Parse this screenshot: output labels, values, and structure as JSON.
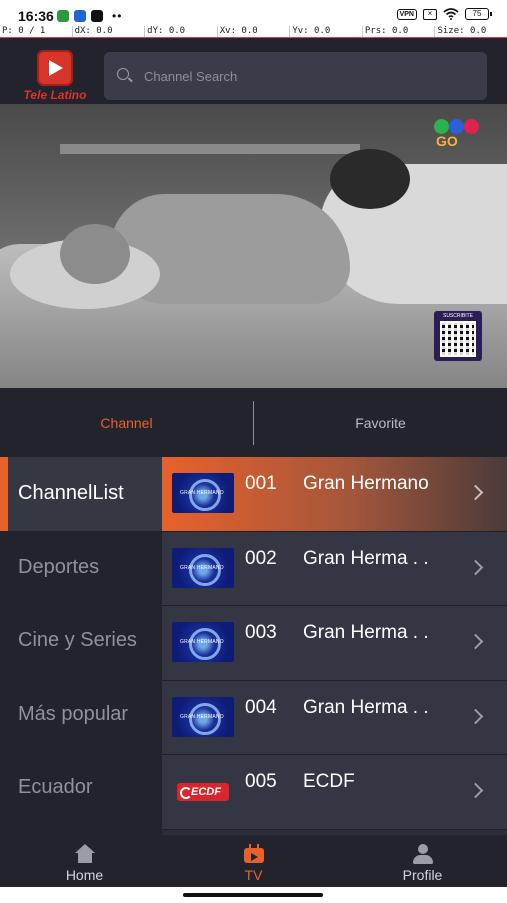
{
  "status_bar": {
    "time": "16:36",
    "vpn": "VPN",
    "battery": "75"
  },
  "debug": {
    "p": "P: 0 / 1",
    "dx": "dX: 0.0",
    "dy": "dY: 0.0",
    "xv": "Xv: 0.0",
    "yv": "Yv: 0.0",
    "prs": "Prs: 0.0",
    "size": "Size: 0.0"
  },
  "header": {
    "logo_text": "Tele Latino",
    "search_placeholder": "Channel Search"
  },
  "video": {
    "qr_label": "SUSCRIBITE",
    "watermark": "GO"
  },
  "tabs": [
    {
      "label": "Channel",
      "active": true
    },
    {
      "label": "Favorite",
      "active": false
    }
  ],
  "categories": [
    {
      "label": "ChannelList",
      "active": true
    },
    {
      "label": "Deportes",
      "active": false
    },
    {
      "label": "Cine y Series",
      "active": false
    },
    {
      "label": "Más popular",
      "active": false
    },
    {
      "label": "Ecuador",
      "active": false
    }
  ],
  "channels": [
    {
      "number": "001",
      "name": "Gran Hermano",
      "thumbnail": "gran-hermano-logo"
    },
    {
      "number": "002",
      "name": "Gran Herma . .",
      "thumbnail": "gran-hermano-logo"
    },
    {
      "number": "003",
      "name": "Gran Herma . .",
      "thumbnail": "gran-hermano-logo"
    },
    {
      "number": "004",
      "name": "Gran Herma . .",
      "thumbnail": "gran-hermano-logo"
    },
    {
      "number": "005",
      "name": "ECDF",
      "thumbnail": "ecdf-logo",
      "logo_text": "ECDF"
    }
  ],
  "bottom_nav": [
    {
      "label": "Home",
      "icon": "home-icon",
      "active": false
    },
    {
      "label": "TV",
      "icon": "tv-icon",
      "active": true
    },
    {
      "label": "Profile",
      "icon": "profile-icon",
      "active": false
    }
  ],
  "colors": {
    "accent": "#e8612b",
    "background": "#22232d",
    "panel": "#343643"
  }
}
